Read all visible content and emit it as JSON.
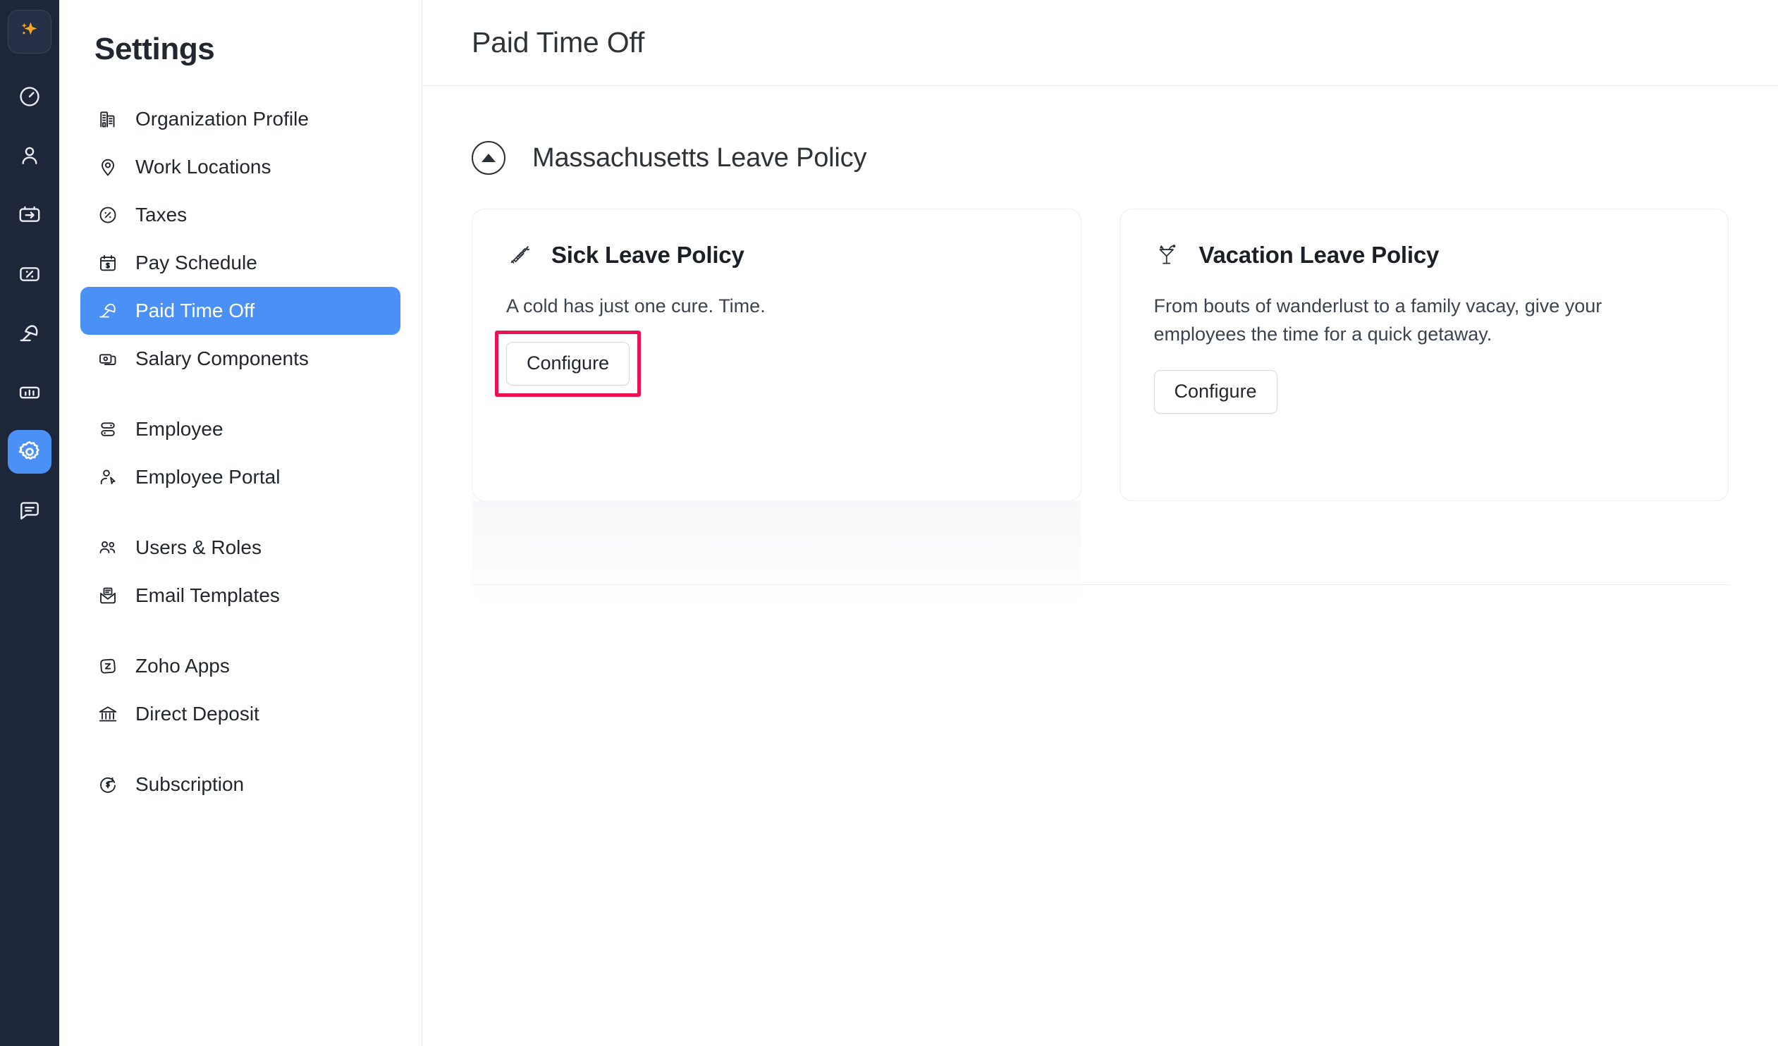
{
  "rail": {
    "items": [
      {
        "name": "ai-sparkle-icon",
        "label": "AI Assistant",
        "state": "idle"
      },
      {
        "name": "clock-icon",
        "label": "Time Tracking",
        "state": "idle"
      },
      {
        "name": "person-icon",
        "label": "Employees",
        "state": "idle"
      },
      {
        "name": "pay-run-icon",
        "label": "Pay Runs",
        "state": "idle"
      },
      {
        "name": "tax-percent-icon",
        "label": "Taxes",
        "state": "idle"
      },
      {
        "name": "umbrella-icon",
        "label": "Time Off",
        "state": "idle"
      },
      {
        "name": "bar-chart-icon",
        "label": "Reports",
        "state": "idle"
      },
      {
        "name": "gear-icon",
        "label": "Settings",
        "state": "active"
      },
      {
        "name": "chat-icon",
        "label": "Messages",
        "state": "idle"
      }
    ],
    "accent_active": "#4a90f5",
    "accent_ai": "#f5a623",
    "background": "#1e2639"
  },
  "sidebar": {
    "title": "Settings",
    "selected": "Paid Time Off",
    "groups": [
      {
        "items": [
          {
            "label": "Organization Profile",
            "icon": "organization-icon"
          },
          {
            "label": "Work Locations",
            "icon": "map-pin-icon"
          },
          {
            "label": "Taxes",
            "icon": "percent-circle-icon"
          },
          {
            "label": "Pay Schedule",
            "icon": "calendar-dollar-icon"
          },
          {
            "label": "Paid Time Off",
            "icon": "beach-umbrella-icon"
          },
          {
            "label": "Salary Components",
            "icon": "salary-cards-icon"
          }
        ]
      },
      {
        "items": [
          {
            "label": "Employee",
            "icon": "employee-rows-icon"
          },
          {
            "label": "Employee Portal",
            "icon": "person-cursor-icon"
          }
        ]
      },
      {
        "items": [
          {
            "label": "Users & Roles",
            "icon": "users-group-icon"
          },
          {
            "label": "Email Templates",
            "icon": "email-template-icon"
          }
        ]
      },
      {
        "items": [
          {
            "label": "Zoho Apps",
            "icon": "zoho-apps-icon"
          },
          {
            "label": "Direct Deposit",
            "icon": "bank-icon"
          }
        ]
      },
      {
        "items": [
          {
            "label": "Subscription",
            "icon": "subscription-dollar-icon"
          }
        ]
      }
    ]
  },
  "main": {
    "page_title": "Paid Time Off",
    "section": {
      "title": "Massachusetts Leave Policy",
      "collapse_icon": "caret-up-circle-icon",
      "expanded": true
    },
    "cards": [
      {
        "emoji_name": "syringe-icon",
        "title": "Sick Leave Policy",
        "description": "A cold has just one cure. Time.",
        "button_label": "Configure",
        "highlighted": true,
        "highlight_color": "#ea1350"
      },
      {
        "emoji_name": "cocktail-icon",
        "title": "Vacation Leave Policy",
        "description": "From bouts of wanderlust to a family vacay, give your employees the time for a quick getaway.",
        "button_label": "Configure",
        "highlighted": false
      }
    ]
  }
}
